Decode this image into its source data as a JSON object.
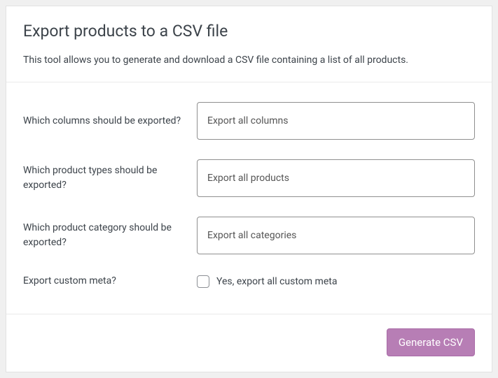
{
  "header": {
    "title": "Export products to a CSV file",
    "description": "This tool allows you to generate and download a CSV file containing a list of all products."
  },
  "fields": {
    "columns": {
      "label": "Which columns should be exported?",
      "placeholder": "Export all columns"
    },
    "product_types": {
      "label": "Which product types should be exported?",
      "placeholder": "Export all products"
    },
    "product_category": {
      "label": "Which product category should be exported?",
      "placeholder": "Export all categories"
    },
    "custom_meta": {
      "label": "Export custom meta?",
      "checkbox_label": "Yes, export all custom meta"
    }
  },
  "footer": {
    "generate_label": "Generate CSV"
  }
}
